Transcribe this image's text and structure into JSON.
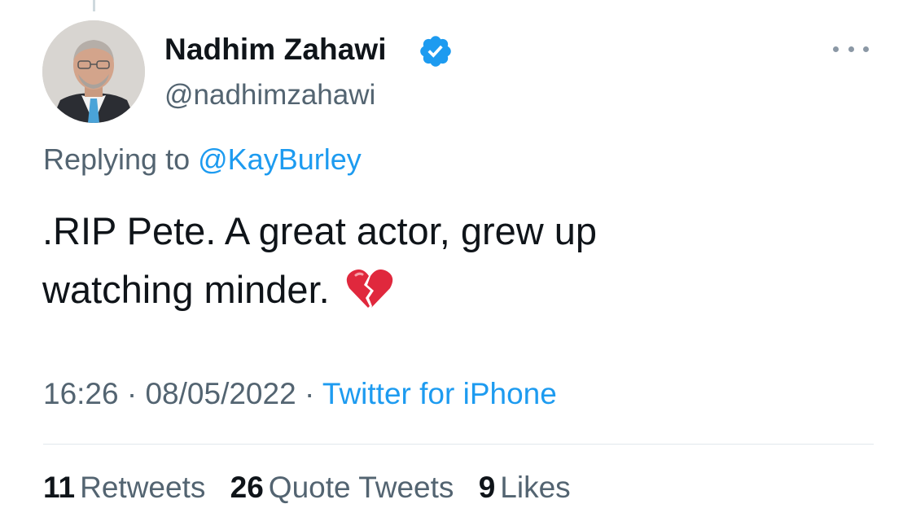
{
  "author": {
    "name": "Nadhim Zahawi",
    "handle": "@nadhimzahawi",
    "verified": true
  },
  "reply": {
    "prefix": "Replying to",
    "mention": "@KayBurley"
  },
  "tweet": {
    "line1": ".RIP Pete. A great actor, grew up",
    "line2": "watching minder.",
    "emoji_icon": "broken-heart-icon"
  },
  "meta": {
    "time": "16:26",
    "separator": "·",
    "date": "08/05/2022",
    "source": "Twitter for iPhone"
  },
  "stats": {
    "retweets_count": "11",
    "retweets_label": "Retweets",
    "quotes_count": "26",
    "quotes_label": "Quote Tweets",
    "likes_count": "9",
    "likes_label": "Likes"
  },
  "colors": {
    "accent": "#1d9bf0",
    "text_primary": "#0f1419",
    "text_secondary": "#536471",
    "verified_badge": "#1d9bf0",
    "emoji_red": "#e0283d"
  }
}
